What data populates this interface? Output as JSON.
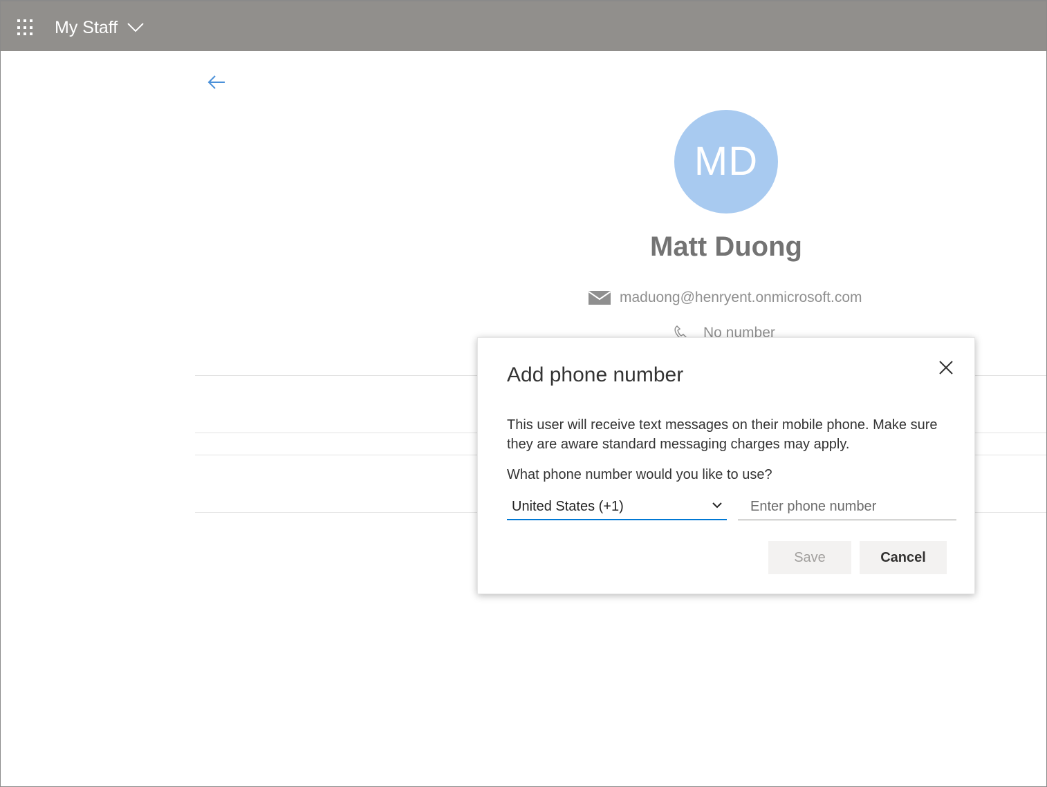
{
  "header": {
    "app_title": "My Staff",
    "waffle_icon": "app-launcher-icon",
    "chevron_icon": "chevron-down-icon",
    "bar_color": "#918f8c"
  },
  "profile": {
    "initials": "MD",
    "name": "Matt Duong",
    "email": "maduong@henryent.onmicrosoft.com",
    "phone": "No number",
    "avatar_color": "#a8caf0"
  },
  "dialog": {
    "title": "Add phone number",
    "description": "This user will receive text messages on their mobile phone. Make sure they are aware standard messaging charges may apply.",
    "question": "What phone number would you like to use?",
    "country_value": "United States (+1)",
    "phone_placeholder": "Enter phone number",
    "phone_value": "",
    "save_label": "Save",
    "cancel_label": "Cancel",
    "accent_color": "#0078d4"
  }
}
